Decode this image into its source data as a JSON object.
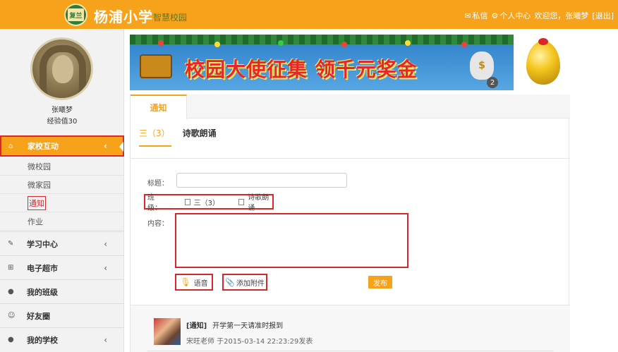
{
  "header": {
    "school_name": "杨浦小学",
    "school_sub": "智慧校园",
    "logo_text": "复兰",
    "nav": {
      "messages": "私信",
      "user_center": "个人中心",
      "welcome": "欢迎您，张曦梦",
      "logout": "[退出]"
    }
  },
  "user": {
    "name": "张曦梦",
    "exp": "经验值30"
  },
  "sidebar": {
    "active": {
      "label": "家校互动",
      "icon": "home-icon"
    },
    "subs": [
      "微校园",
      "微家园",
      "通知",
      "作业"
    ],
    "items": [
      {
        "label": "学习中心",
        "icon": "edit-icon"
      },
      {
        "label": "电子超市",
        "icon": "cart-icon"
      },
      {
        "label": "我的班级",
        "icon": "user-icon"
      },
      {
        "label": "好友圈",
        "icon": "smile-icon"
      },
      {
        "label": "我的学校",
        "icon": "users-icon"
      }
    ]
  },
  "banner": {
    "text": "校园大使征集 领千元奖金",
    "bag_symbol": "$",
    "badge": "2"
  },
  "notice": {
    "tab": "通知",
    "class_tabs": [
      "三（3）",
      "诗歌朗诵"
    ],
    "form": {
      "title_label": "标题：",
      "title_value": "",
      "class_label": "班级：",
      "class_options": [
        "三（3）",
        "诗歌朗诵"
      ],
      "content_label": "内容：",
      "content_value": "",
      "voice_button": "语音",
      "attach_button": "添加附件",
      "publish_button": "发布"
    },
    "feed": [
      {
        "tag": "[通知]",
        "title": "开学第一天请准时报到",
        "meta": "宋旺老师  于2015-03-14 22:23:29发表"
      }
    ]
  },
  "colors": {
    "accent": "#f7a21b",
    "highlight_border": "#d9262b"
  }
}
